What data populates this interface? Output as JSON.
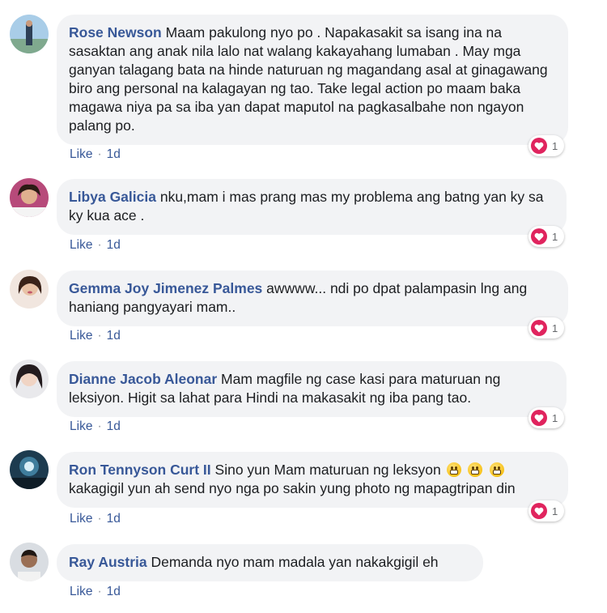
{
  "comments": [
    {
      "author": "Rose Newson",
      "text": "Maam pakulong nyo po . Napakasakit sa isang ina na sasaktan ang anak nila lalo nat walang kakayahang lumaban . May mga ganyan talagang bata na hinde naturuan ng magandang asal at ginagawang biro ang personal na kalagayan ng tao. Take legal action po maam baka magawa niya pa sa iba yan dapat maputol na pagkasalbahe non ngayon palang po.",
      "like_label": "Like",
      "time": "1d",
      "reaction_count": "1"
    },
    {
      "author": "Libya Galicia",
      "text": "nku,mam i mas prang mas my problema ang batng yan ky sa ky kua ace .",
      "like_label": "Like",
      "time": "1d",
      "reaction_count": "1"
    },
    {
      "author": "Gemma Joy Jimenez Palmes",
      "text": "awwww... ndi po dpat palampasin lng ang haniang pangyayari mam..",
      "like_label": "Like",
      "time": "1d",
      "reaction_count": "1"
    },
    {
      "author": "Dianne Jacob Aleonar",
      "text": "Mam magfile ng case kasi para maturuan ng leksiyon. Higit sa lahat para Hindi na makasakit ng iba pang tao.",
      "like_label": "Like",
      "time": "1d",
      "reaction_count": "1"
    },
    {
      "author": "Ron Tennyson Curt II",
      "text": "Sino yun Mam maturuan ng leksyon",
      "text_after_emoji": "kakagigil yun ah send nyo nga po sakin yung photo ng mapagtripan din",
      "emojis": [
        "grimacing-face-emoji",
        "grimacing-face-emoji",
        "grimacing-face-emoji"
      ],
      "like_label": "Like",
      "time": "1d",
      "reaction_count": "1"
    },
    {
      "author": "Ray Austria",
      "text": "Demanda nyo mam madala yan nakakgigil eh",
      "like_label": "Like",
      "time": "1d"
    }
  ],
  "reaction_icon": "heart-reaction-icon",
  "colors": {
    "author": "#385898",
    "bubble": "#f2f3f5",
    "meta": "#90949c",
    "heart": "#e0245e"
  }
}
